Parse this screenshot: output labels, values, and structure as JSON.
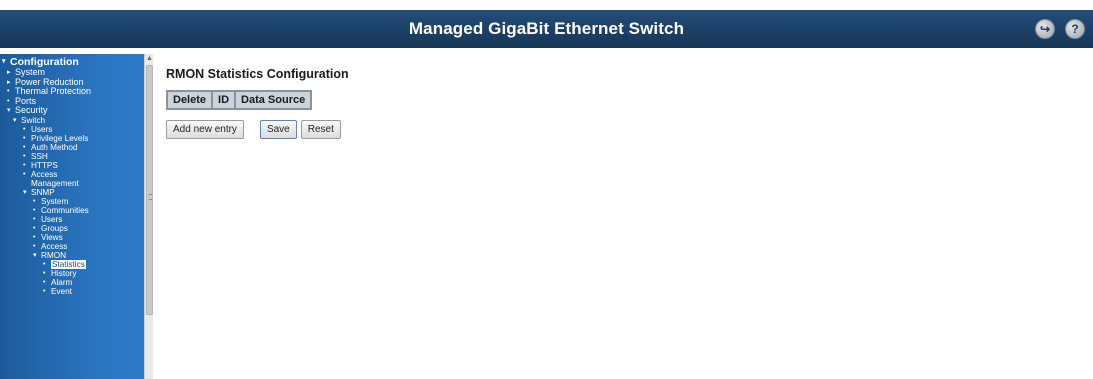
{
  "header": {
    "title": "Managed GigaBit Ethernet Switch",
    "icons": [
      "logout-icon",
      "help-icon"
    ]
  },
  "sidebar": {
    "items": [
      {
        "label": "Configuration",
        "marker": "▾",
        "level": "l0"
      },
      {
        "label": "System",
        "marker": "▸",
        "level": "l1"
      },
      {
        "label": "Power Reduction",
        "marker": "▸",
        "level": "l1"
      },
      {
        "label": "Thermal Protection",
        "marker": "•",
        "level": "l1"
      },
      {
        "label": "Ports",
        "marker": "•",
        "level": "l1"
      },
      {
        "label": "Security",
        "marker": "▾",
        "level": "l1"
      },
      {
        "label": "Switch",
        "marker": "▾",
        "level": "l2"
      },
      {
        "label": "Users",
        "marker": "•",
        "level": "l3"
      },
      {
        "label": "Privilege Levels",
        "marker": "•",
        "level": "l3"
      },
      {
        "label": "Auth Method",
        "marker": "•",
        "level": "l3"
      },
      {
        "label": "SSH",
        "marker": "•",
        "level": "l3"
      },
      {
        "label": "HTTPS",
        "marker": "•",
        "level": "l3"
      },
      {
        "label": "Access",
        "marker": "•",
        "level": "l3"
      },
      {
        "label": "Management",
        "marker": "",
        "level": "l3w"
      },
      {
        "label": "SNMP",
        "marker": "▾",
        "level": "l3"
      },
      {
        "label": "System",
        "marker": "•",
        "level": "l4"
      },
      {
        "label": "Communities",
        "marker": "•",
        "level": "l4"
      },
      {
        "label": "Users",
        "marker": "•",
        "level": "l4"
      },
      {
        "label": "Groups",
        "marker": "•",
        "level": "l4"
      },
      {
        "label": "Views",
        "marker": "•",
        "level": "l4"
      },
      {
        "label": "Access",
        "marker": "•",
        "level": "l4"
      },
      {
        "label": "RMON",
        "marker": "▾",
        "level": "l4"
      },
      {
        "label": "Statistics",
        "marker": "•",
        "level": "l5",
        "selected": true
      },
      {
        "label": "History",
        "marker": "•",
        "level": "l5"
      },
      {
        "label": "Alarm",
        "marker": "•",
        "level": "l5"
      },
      {
        "label": "Event",
        "marker": "•",
        "level": "l5"
      }
    ]
  },
  "main": {
    "title": "RMON Statistics Configuration",
    "table_headers": [
      "Delete",
      "ID",
      "Data Source"
    ],
    "buttons": {
      "add": "Add new entry",
      "save": "Save",
      "reset": "Reset"
    }
  },
  "colors": {
    "header_bg": "#1b3f66",
    "sidebar_bg": "#2a74bf",
    "table_header_bg": "#cbd3dc"
  }
}
